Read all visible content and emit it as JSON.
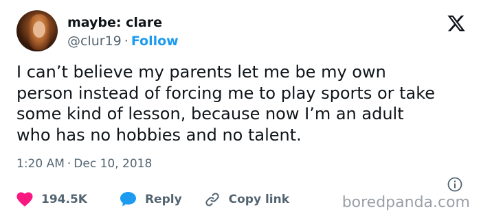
{
  "author": {
    "display_name": "maybe: clare",
    "handle": "@clur19",
    "separator": "·",
    "follow_label": "Follow"
  },
  "tweet": {
    "lines": [
      "I can’t believe my parents let me be my own",
      "person instead of forcing me to play sports or take",
      "some kind of lesson, because now I’m an adult",
      "who has no hobbies and no talent."
    ]
  },
  "meta": {
    "time": "1:20 AM",
    "separator": "·",
    "date": "Dec 10, 2018"
  },
  "actions": {
    "likes_count": "194.5K",
    "reply_label": "Reply",
    "copy_link_label": "Copy link"
  },
  "watermark": "boredpanda.com",
  "icons": {
    "logo": "x-logo-icon",
    "like": "heart-icon",
    "reply": "speech-bubble-icon",
    "copy_link": "link-icon",
    "info": "info-icon"
  },
  "colors": {
    "text": "#0f1419",
    "secondary": "#536471",
    "accent_blue": "#1d9bf0",
    "like_pink": "#f91880",
    "watermark": "#9aa0a6"
  }
}
